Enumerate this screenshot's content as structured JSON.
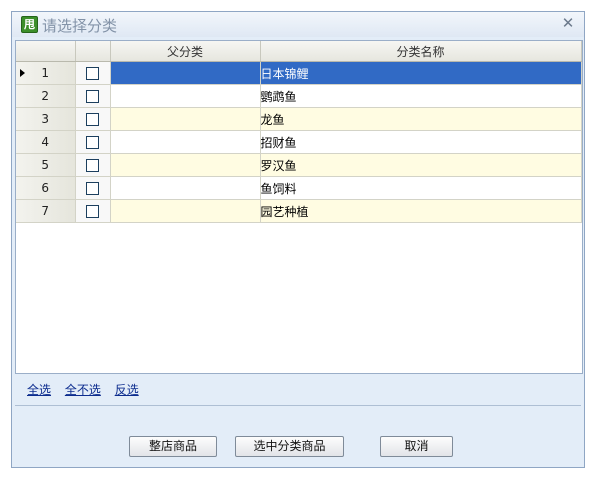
{
  "window": {
    "title": "请选择分类",
    "app_icon_glyph": "甩"
  },
  "grid": {
    "columns": [
      "",
      "",
      "父分类",
      "分类名称"
    ],
    "rows": [
      {
        "num": "1",
        "parent": "",
        "name": "日本锦鲤",
        "checked": false,
        "selected": true
      },
      {
        "num": "2",
        "parent": "",
        "name": "鹦鹉鱼",
        "checked": false,
        "selected": false
      },
      {
        "num": "3",
        "parent": "",
        "name": "龙鱼",
        "checked": false,
        "selected": false
      },
      {
        "num": "4",
        "parent": "",
        "name": "招财鱼",
        "checked": false,
        "selected": false
      },
      {
        "num": "5",
        "parent": "",
        "name": "罗汉鱼",
        "checked": false,
        "selected": false
      },
      {
        "num": "6",
        "parent": "",
        "name": "鱼饲料",
        "checked": false,
        "selected": false
      },
      {
        "num": "7",
        "parent": "",
        "name": "园艺种植",
        "checked": false,
        "selected": false
      }
    ]
  },
  "links": {
    "select_all": "全选",
    "select_none": "全不选",
    "invert": "反选"
  },
  "buttons": {
    "whole_store": "整店商品",
    "selected_category": "选中分类商品",
    "cancel": "取消"
  },
  "colors": {
    "selection": "#316ac5",
    "odd_row": "#fffce2",
    "link": "#0c2c8e"
  }
}
